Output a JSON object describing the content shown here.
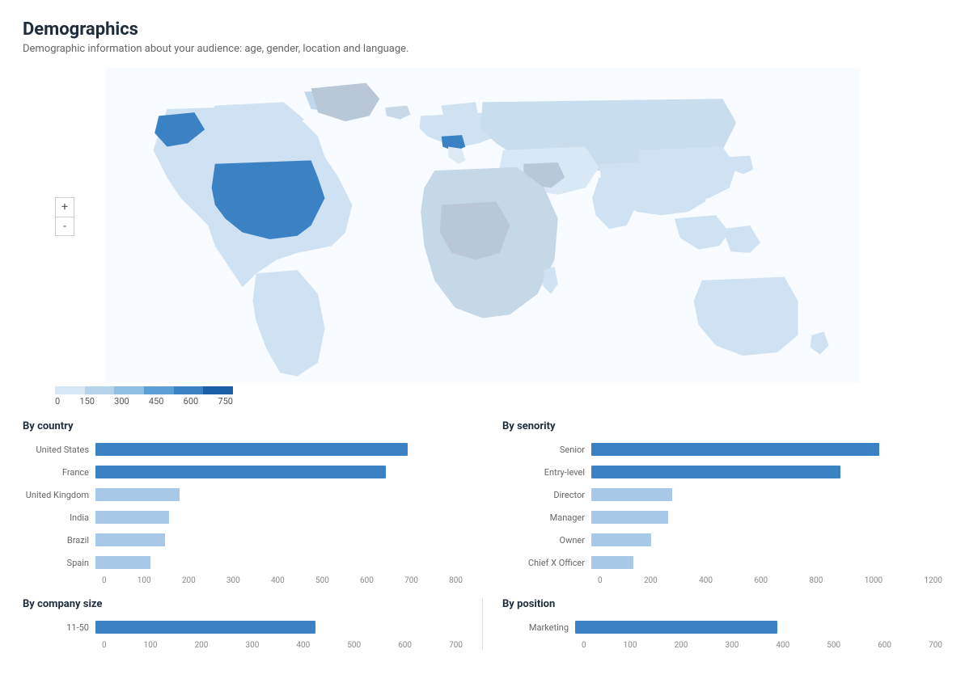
{
  "page": {
    "title": "Demographics",
    "subtitle": "Demographic information about your audience: age, gender, location and language."
  },
  "map": {
    "zoom_in": "+",
    "zoom_out": "-",
    "legend_labels": [
      "0",
      "150",
      "300",
      "450",
      "600",
      "750"
    ],
    "legend_colors": [
      "#d6e8f5",
      "#b5d4ec",
      "#8fc0e3",
      "#5aa0d6",
      "#3b82c4",
      "#1a5fa8"
    ]
  },
  "by_country": {
    "title": "By country",
    "bars": [
      {
        "label": "United States",
        "value": 680,
        "max": 800,
        "primary": true
      },
      {
        "label": "France",
        "value": 630,
        "max": 800,
        "primary": true
      },
      {
        "label": "United Kingdom",
        "value": 185,
        "max": 800,
        "primary": false
      },
      {
        "label": "India",
        "value": 160,
        "max": 800,
        "primary": false
      },
      {
        "label": "Brazil",
        "value": 150,
        "max": 800,
        "primary": false
      },
      {
        "label": "Spain",
        "value": 120,
        "max": 800,
        "primary": false
      }
    ],
    "x_labels": [
      "0",
      "100",
      "200",
      "300",
      "400",
      "500",
      "600",
      "700",
      "800"
    ]
  },
  "by_senority": {
    "title": "By senority",
    "bars": [
      {
        "label": "Senior",
        "value": 990,
        "max": 1200,
        "primary": true
      },
      {
        "label": "Entry-level",
        "value": 850,
        "max": 1200,
        "primary": true
      },
      {
        "label": "Director",
        "value": 280,
        "max": 1200,
        "primary": false
      },
      {
        "label": "Manager",
        "value": 260,
        "max": 1200,
        "primary": false
      },
      {
        "label": "Owner",
        "value": 200,
        "max": 1200,
        "primary": false
      },
      {
        "label": "Chief X Officer",
        "value": 140,
        "max": 1200,
        "primary": false
      }
    ],
    "x_labels": [
      "0",
      "200",
      "400",
      "600",
      "800",
      "1000",
      "1200"
    ]
  },
  "by_company_size": {
    "title": "By company size",
    "bars": [
      {
        "label": "11-50",
        "value": 400,
        "max": 800,
        "primary": true
      }
    ],
    "x_labels": [
      "0",
      "100",
      "200",
      "300",
      "400",
      "500",
      "600",
      "700"
    ]
  },
  "by_position": {
    "title": "By position",
    "bars": [
      {
        "label": "Marketing",
        "value": 380,
        "max": 800,
        "primary": true
      }
    ],
    "x_labels": [
      "0",
      "100",
      "200",
      "300",
      "400",
      "500",
      "600",
      "700"
    ]
  }
}
